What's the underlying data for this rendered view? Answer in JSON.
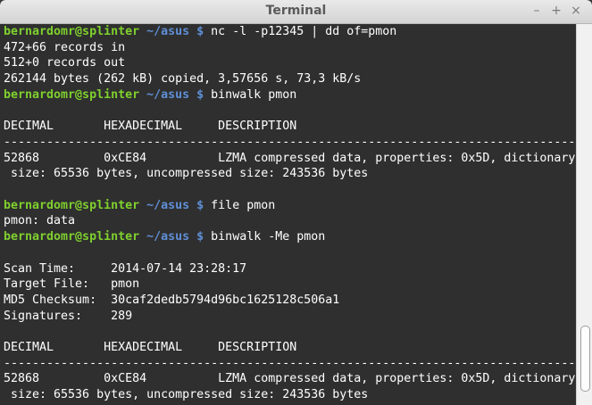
{
  "window": {
    "title": "Terminal",
    "minimize": "–",
    "maximize": "+",
    "close": "×"
  },
  "lines": [
    {
      "user": "bernardomr@splinter",
      "path": " ~/asus $ ",
      "text": "nc -l -p12345 | dd of=pmon"
    },
    {
      "text": "472+66 records in"
    },
    {
      "text": "512+0 records out"
    },
    {
      "text": "262144 bytes (262 kB) copied, 3,57656 s, 73,3 kB/s"
    },
    {
      "user": "bernardomr@splinter",
      "path": " ~/asus $ ",
      "text": "binwalk pmon"
    },
    {
      "text": ""
    },
    {
      "text": "DECIMAL       HEXADECIMAL     DESCRIPTION"
    },
    {
      "text": "--------------------------------------------------------------------------------"
    },
    {
      "text": "52868         0xCE84          LZMA compressed data, properties: 0x5D, dictionary"
    },
    {
      "text": " size: 65536 bytes, uncompressed size: 243536 bytes"
    },
    {
      "text": ""
    },
    {
      "user": "bernardomr@splinter",
      "path": " ~/asus $ ",
      "text": "file pmon"
    },
    {
      "text": "pmon: data"
    },
    {
      "user": "bernardomr@splinter",
      "path": " ~/asus $ ",
      "text": "binwalk -Me pmon"
    },
    {
      "text": ""
    },
    {
      "text": "Scan Time:     2014-07-14 23:28:17"
    },
    {
      "text": "Target File:   pmon"
    },
    {
      "text": "MD5 Checksum:  30caf2dedb5794d96bc1625128c506a1"
    },
    {
      "text": "Signatures:    289"
    },
    {
      "text": ""
    },
    {
      "text": "DECIMAL       HEXADECIMAL     DESCRIPTION"
    },
    {
      "text": "--------------------------------------------------------------------------------"
    },
    {
      "text": "52868         0xCE84          LZMA compressed data, properties: 0x5D, dictionary"
    },
    {
      "text": " size: 65536 bytes, uncompressed size: 243536 bytes"
    }
  ],
  "colors": {
    "user": "#7fd02e",
    "path": "#5f8fd6",
    "text": "#ffffff",
    "background": "#2f2f2f"
  }
}
